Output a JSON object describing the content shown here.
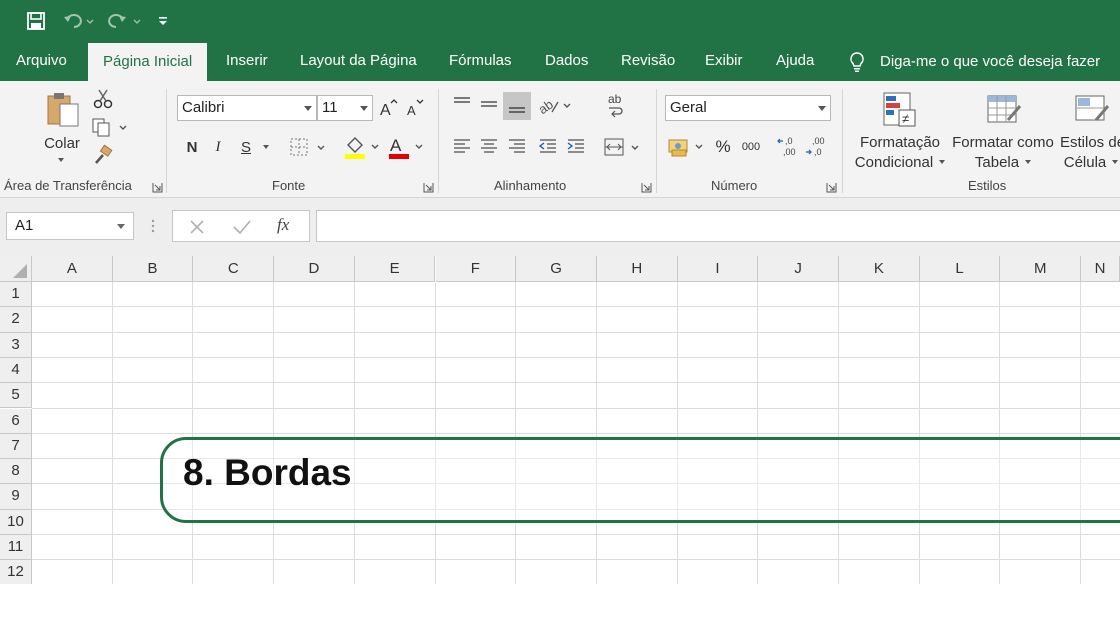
{
  "app": {
    "accent": "#217346"
  },
  "quick_access": {
    "save_icon": "save-icon",
    "undo_icon": "undo-icon",
    "redo_icon": "redo-icon",
    "customize_icon": "customize-qat-icon"
  },
  "tabs": [
    {
      "label": "Arquivo"
    },
    {
      "label": "Página Inicial",
      "active": true
    },
    {
      "label": "Inserir"
    },
    {
      "label": "Layout da Página"
    },
    {
      "label": "Fórmulas"
    },
    {
      "label": "Dados"
    },
    {
      "label": "Revisão"
    },
    {
      "label": "Exibir"
    },
    {
      "label": "Ajuda"
    }
  ],
  "tell_me": "Diga-me o que você deseja fazer",
  "ribbon": {
    "clipboard": {
      "label": "Área de Transferência",
      "paste_label": "Colar"
    },
    "font": {
      "label": "Fonte",
      "font_name": "Calibri",
      "font_size": "11",
      "bold": "N",
      "italic": "I",
      "underline": "S",
      "fill_color": "#ffff00",
      "font_color": "#e00000"
    },
    "alignment": {
      "label": "Alinhamento"
    },
    "number": {
      "label": "Número",
      "format": "Geral",
      "percent": "%",
      "thousands": "000"
    },
    "styles": {
      "label": "Estilos",
      "conditional_line1": "Formatação",
      "conditional_line2": "Condicional",
      "table_line1": "Formatar como",
      "table_line2": "Tabela",
      "cell_line1": "Estilos de",
      "cell_line2": "Célula"
    }
  },
  "formula_bar": {
    "name_box": "A1",
    "fx": "fx",
    "value": ""
  },
  "grid": {
    "columns": [
      "A",
      "B",
      "C",
      "D",
      "E",
      "F",
      "G",
      "H",
      "I",
      "J",
      "K",
      "L",
      "M",
      "N"
    ],
    "rows": [
      "1",
      "2",
      "3",
      "4",
      "5",
      "6",
      "7",
      "8",
      "9",
      "10",
      "11",
      "12"
    ]
  },
  "callout": {
    "text": "8. Bordas"
  }
}
